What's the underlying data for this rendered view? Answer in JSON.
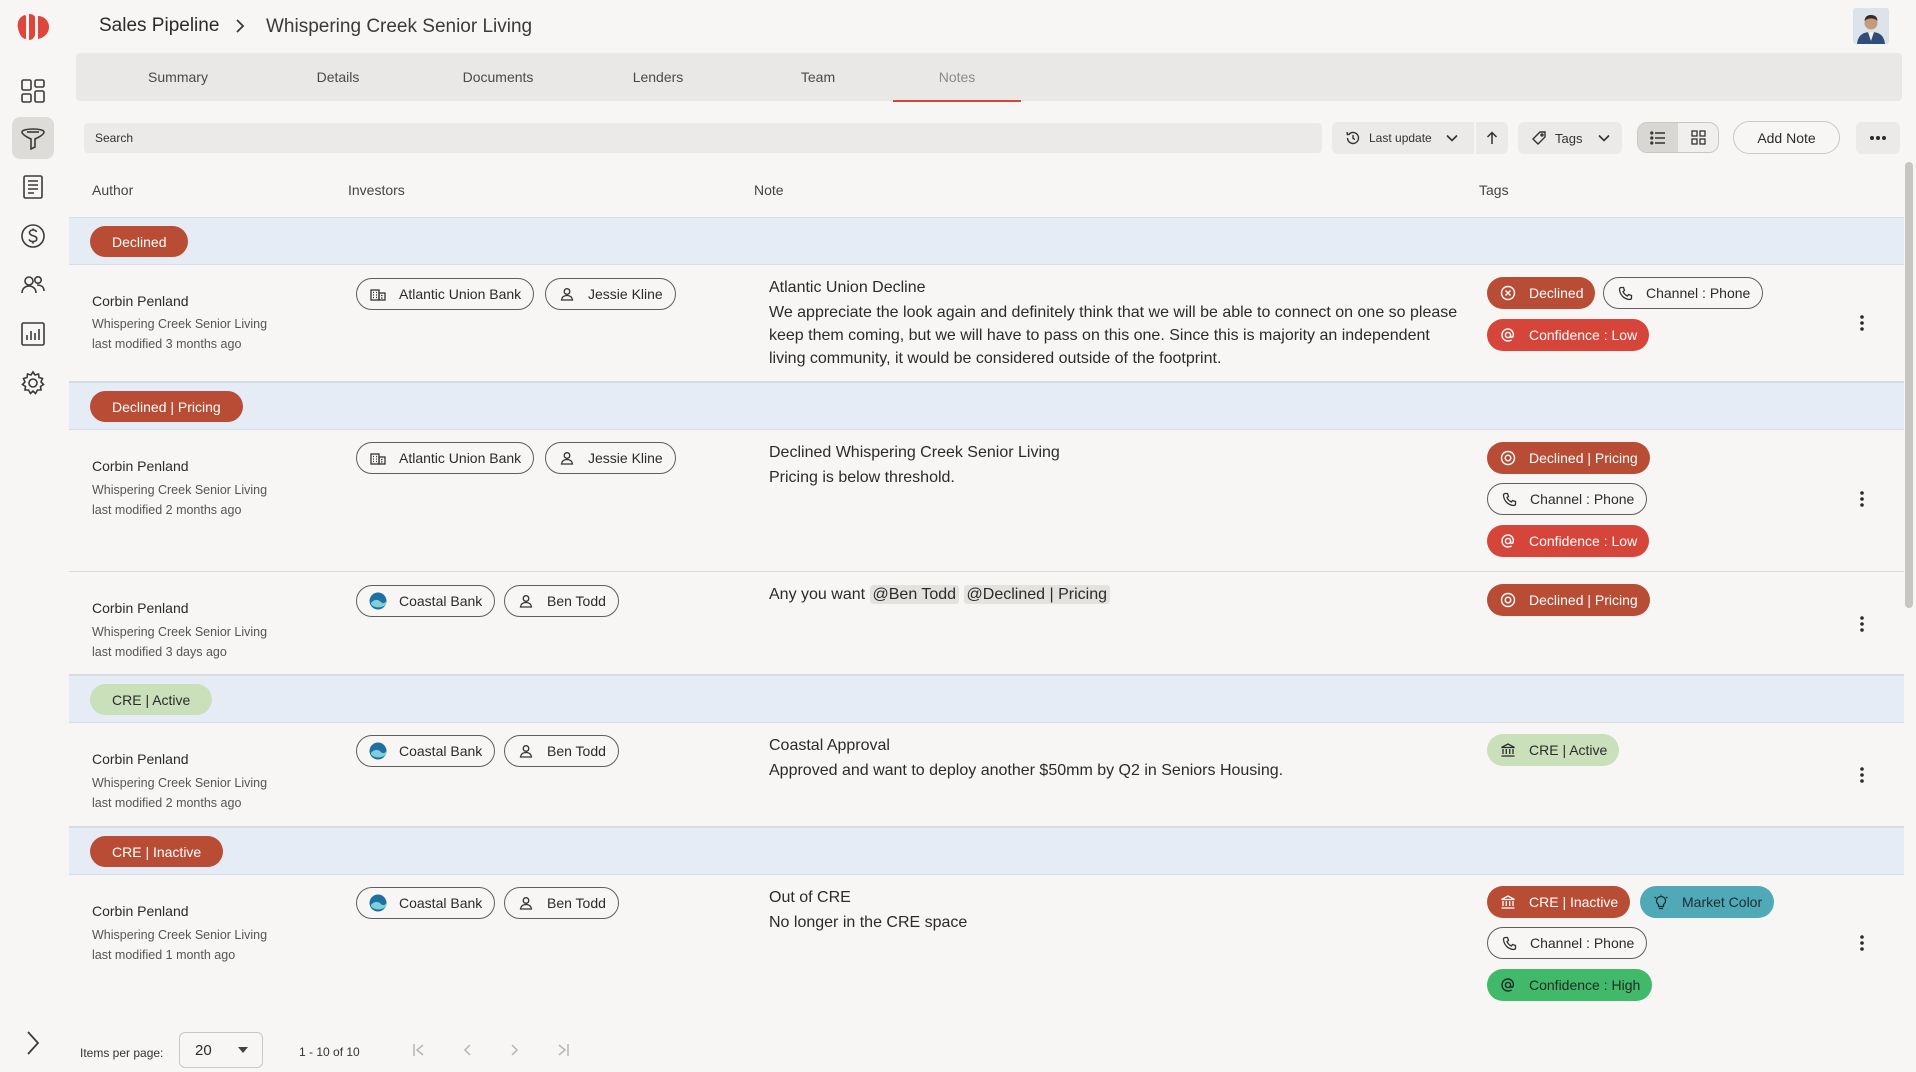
{
  "breadcrumb": {
    "root": "Sales Pipeline",
    "current": "Whispering Creek Senior Living"
  },
  "tabs": [
    "Summary",
    "Details",
    "Documents",
    "Lenders",
    "Team",
    "Notes"
  ],
  "toolbar": {
    "search_placeholder": "Search",
    "sort_label": "Last update",
    "tags_label": "Tags",
    "add_note_label": "Add Note"
  },
  "columns": {
    "author": "Author",
    "investors": "Investors",
    "note": "Note",
    "tags": "Tags"
  },
  "groups": [
    {
      "label": "Declined",
      "style": "red"
    },
    {
      "label": "Declined | Pricing",
      "style": "red"
    },
    {
      "label": "CRE | Active",
      "style": "green"
    },
    {
      "label": "CRE | Inactive",
      "style": "red"
    }
  ],
  "rows": [
    {
      "author": "Corbin Penland",
      "deal": "Whispering Creek Senior Living",
      "modified": "last modified 3 months ago",
      "investors": [
        "Atlantic Union Bank",
        "Jessie Kline"
      ],
      "note_title": "Atlantic Union Decline",
      "note_body": "We appreciate the look again and definitely think that we will be able to connect on one so please keep them coming, but we will have to pass on this one. Since this is majority an independent living community, it would be considered outside of the footprint.",
      "tags": [
        "Declined",
        "Channel : Phone",
        "Confidence : Low"
      ]
    },
    {
      "author": "Corbin Penland",
      "deal": "Whispering Creek Senior Living",
      "modified": "last modified 2 months ago",
      "investors": [
        "Atlantic Union Bank",
        "Jessie Kline"
      ],
      "note_title": "Declined Whispering Creek Senior Living",
      "note_body": "Pricing is below threshold.",
      "tags": [
        "Declined | Pricing",
        "Channel : Phone",
        "Confidence : Low"
      ]
    },
    {
      "author": "Corbin Penland",
      "deal": "Whispering Creek Senior Living",
      "modified": "last modified 3 days ago",
      "investors": [
        "Coastal Bank",
        "Ben Todd"
      ],
      "note_text": "Any you want",
      "mentions": [
        "@Ben Todd",
        "@Declined | Pricing"
      ],
      "tags": [
        "Declined | Pricing"
      ]
    },
    {
      "author": "Corbin Penland",
      "deal": "Whispering Creek Senior Living",
      "modified": "last modified 2 months ago",
      "investors": [
        "Coastal Bank",
        "Ben Todd"
      ],
      "note_title": "Coastal Approval",
      "note_body": "Approved and want to deploy another $50mm by Q2 in Seniors Housing.",
      "tags": [
        "CRE | Active"
      ]
    },
    {
      "author": "Corbin Penland",
      "deal": "Whispering Creek Senior Living",
      "modified": "last modified 1 month ago",
      "investors": [
        "Coastal Bank",
        "Ben Todd"
      ],
      "note_title": "Out of CRE",
      "note_body": "No longer in the CRE space",
      "tags": [
        "CRE | Inactive",
        "Market Color",
        "Channel : Phone",
        "Confidence : High"
      ]
    }
  ],
  "pagination": {
    "items_per_page_label": "Items per page:",
    "items_per_page": "20",
    "range": "1 - 10 of 10"
  },
  "colors": {
    "accent": "#d5453a",
    "declined": "#b94c34",
    "low": "#d6453a",
    "active": "#c9e0bb",
    "market": "#4fa9b6",
    "high": "#41b96a"
  }
}
